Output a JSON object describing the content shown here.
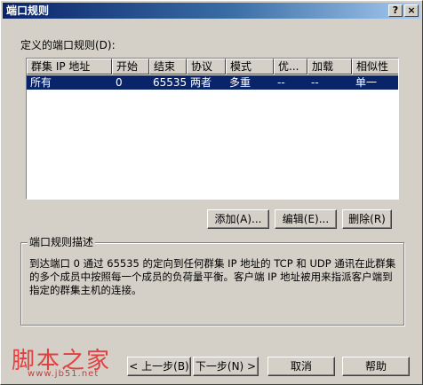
{
  "window": {
    "title": "端口规则",
    "help_glyph": "?",
    "close_glyph": "×"
  },
  "rules_label": "定义的端口规则(D):",
  "table": {
    "columns": [
      "群集 IP 地址",
      "开始",
      "结束",
      "协议",
      "模式",
      "优...",
      "加载",
      "相似性"
    ],
    "rows": [
      [
        "所有",
        "0",
        "65535",
        "两者",
        "多重",
        "--",
        "--",
        "单一"
      ]
    ]
  },
  "buttons": {
    "add": "添加(A)...",
    "edit": "编辑(E)...",
    "remove": "删除(R)",
    "back": "< 上一步(B)",
    "next": "下一步(N) >",
    "cancel": "取消",
    "help": "帮助"
  },
  "description": {
    "title": "端口规则描述",
    "text": "到达端口 0 通过 65535 的定向到任何群集 IP 地址的 TCP 和 UDP 通讯在此群集的多个成员中按照每一个成员的负荷量平衡。客户端 IP 地址被用来指派客户端到指定的群集主机的连接。"
  },
  "watermark": {
    "text": "脚本之家",
    "url": "www.jb51.net"
  }
}
